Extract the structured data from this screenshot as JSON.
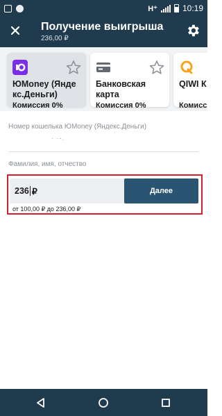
{
  "status_bar": {
    "network": "H⁺",
    "time": "10:19"
  },
  "header": {
    "title": "Получение выигрыша",
    "subtitle": "236,00 ₽",
    "close_icon": "close-icon",
    "settings_icon": "gear-icon"
  },
  "methods": [
    {
      "name": "ЮMoney (Яндекс.Деньги)",
      "name_line1": "ЮMoney (Янде",
      "name_line2": "кс.Деньги)",
      "fee": "Комиссия 0%",
      "selected": true,
      "icon": "yoomoney-logo-icon"
    },
    {
      "name": "Банковская карта",
      "name_line1": "Банковская",
      "name_line2": "карта",
      "fee": "Комиссия 0%",
      "selected": false,
      "icon": "bank-card-icon"
    },
    {
      "name": "QIWI Кошелёк",
      "name_line1": "QIWI К",
      "name_line2": "",
      "fee": "Комиссия",
      "selected": false,
      "icon": "qiwi-logo-icon"
    }
  ],
  "form": {
    "wallet_label": "Номер кошелька ЮMoney (Яндекс.Деньги)",
    "wallet_value": "· ·-.",
    "fullname_label": "Фамилия, имя, отчество",
    "amount_value": "236",
    "currency": "₽",
    "next_label": "Далее",
    "range_text": "от 100,00 ₽ до 236,00 ₽"
  },
  "colors": {
    "header_bg": "#1f3b4d",
    "primary_button": "#2a5572",
    "highlight_border": "#d3202c",
    "yoomoney_purple": "#7a2ee6",
    "qiwi_orange": "#f7a21c"
  },
  "nav": {
    "back_icon": "back-triangle-icon",
    "home_icon": "home-circle-icon",
    "recents_icon": "recents-square-icon"
  }
}
